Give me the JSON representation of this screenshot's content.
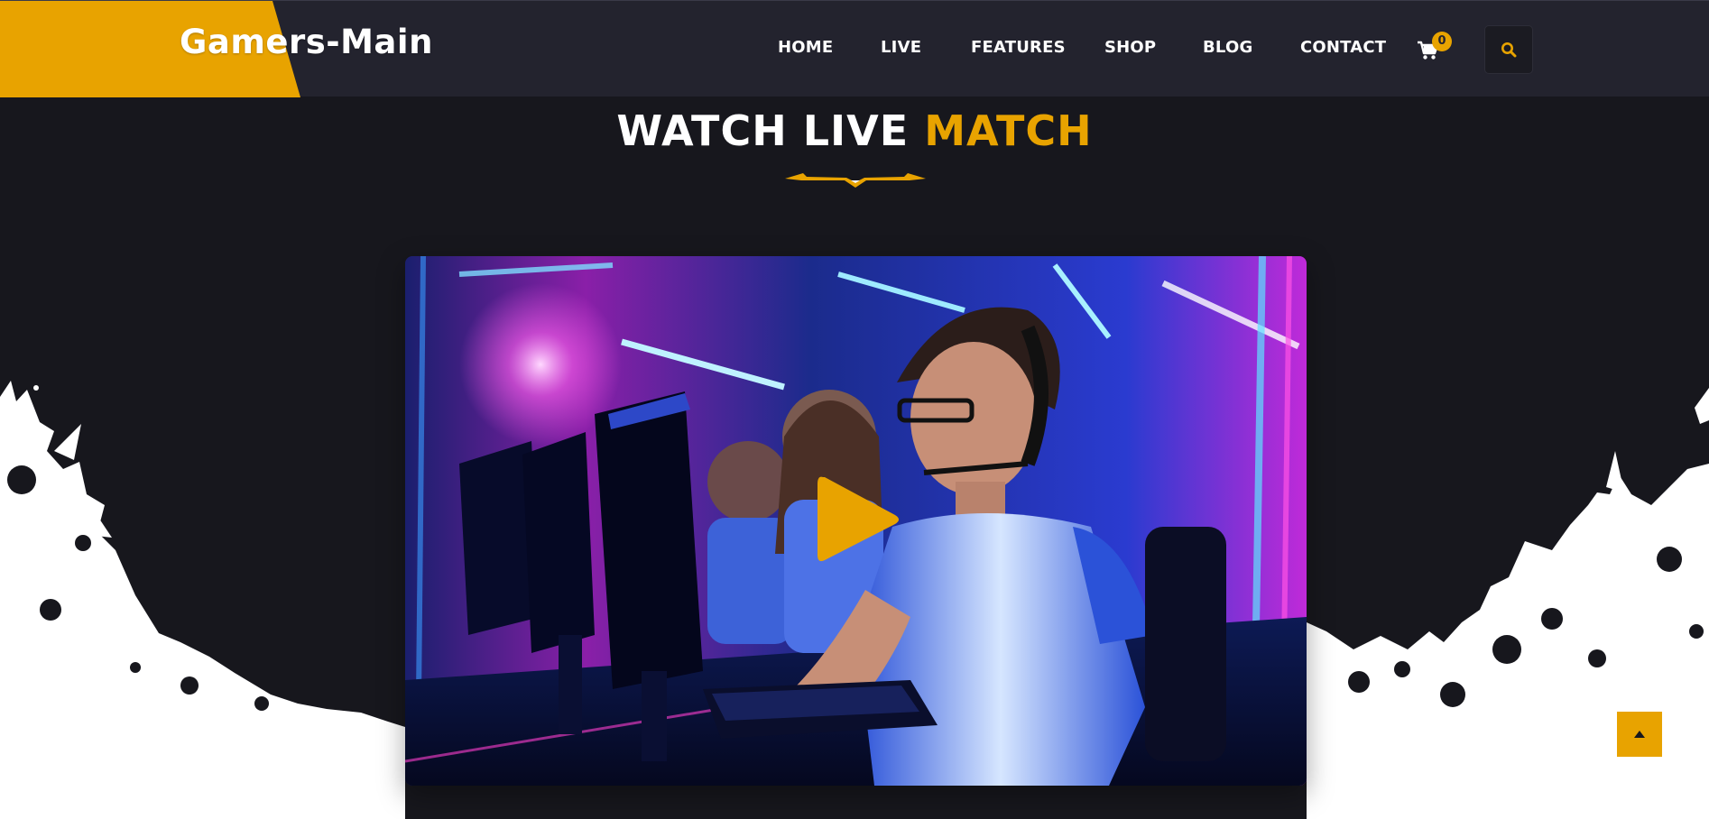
{
  "header": {
    "logo_text": "Gamers-Main",
    "nav": [
      {
        "label": "HOME"
      },
      {
        "label": "LIVE"
      },
      {
        "label": "FEATURES"
      },
      {
        "label": "SHOP"
      },
      {
        "label": "BLOG"
      },
      {
        "label": "CONTACT"
      }
    ],
    "cart_count": "0",
    "cart_icon": "shopping-cart-icon",
    "search_icon": "search-icon"
  },
  "section": {
    "title_white": "WATCH LIVE ",
    "title_accent": "MATCH"
  },
  "video": {
    "play_icon": "play-icon"
  },
  "scroll_top_icon": "arrow-up-icon",
  "colors": {
    "accent": "#e8a300",
    "header_bg": "#23232e",
    "page_bg": "#17171d",
    "splatter": "#ffffff"
  }
}
